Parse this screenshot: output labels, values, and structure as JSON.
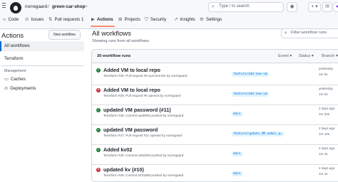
{
  "header": {
    "owner": "norregaard",
    "separator": "/",
    "repo": "green-car-shop",
    "lock_glyph": "⌂",
    "search_placeholder": "Type / to search",
    "plus_glyph": "+ ▾",
    "icon_glyphs": [
      "◉",
      "⇅",
      "✉",
      "●"
    ]
  },
  "tabs": [
    {
      "icon": "‹›",
      "label": "Code"
    },
    {
      "icon": "⊙",
      "label": "Issues"
    },
    {
      "icon": "⇅",
      "label": "Pull requests 1"
    },
    {
      "icon": "▶",
      "label": "Actions"
    },
    {
      "icon": "⊞",
      "label": "Projects"
    },
    {
      "icon": "⛉",
      "label": "Security"
    },
    {
      "icon": "↗",
      "label": "Insights"
    },
    {
      "icon": "⚙",
      "label": "Settings"
    }
  ],
  "sidebar": {
    "title": "Actions",
    "new_workflow": "New workflow",
    "all_workflows": "All workflows",
    "workflow_item": "Terraform",
    "management_heading": "Management",
    "caches_icon": "▭",
    "caches": "Caches",
    "deployments_icon": "⊙",
    "deployments": "Deployments"
  },
  "main": {
    "title": "All workflows",
    "subtitle": "Showing runs from all workflows",
    "filter_placeholder": "Filter workflow runs",
    "run_count": "30 workflow runs",
    "filters": [
      "Event ▾",
      "Status ▾",
      "Branch ▾"
    ]
  },
  "runs": [
    {
      "status": "success",
      "status_glyph": "✓",
      "title": "Added VM to local repo",
      "sub": "Terraform #30: Pull request #5 synchronize by norregaard",
      "branch": "feature/add-new-vm",
      "date": "yesterday",
      "duration": "1m 5s"
    },
    {
      "status": "failure",
      "status_glyph": "✕",
      "title": "Added VM to local repo",
      "sub": "Terraform #29: Pull request #5 opened by norregaard",
      "branch": "feature/add-new-vm",
      "date": "yesterday",
      "duration": "1m 0s"
    },
    {
      "status": "success",
      "status_glyph": "✓",
      "title": "updated VM password (#11)",
      "sub": "Terraform #28: Commit aa48094 pushed by norregaard",
      "branch": "main",
      "date": "2 days ago",
      "duration": "1m 20s"
    },
    {
      "status": "success",
      "status_glyph": "✓",
      "title": "updated VM password",
      "sub": "Terraform #27: Pull request #11 opened by norregaard",
      "branch": "feature/update_VM_admin_p…",
      "date": "2 days ago",
      "duration": "1m 10s"
    },
    {
      "status": "success",
      "status_glyph": "✓",
      "title": "Added kv02",
      "sub": "Terraform #26: Commit e2bd260 pushed by norregaard",
      "branch": "main",
      "date": "2 days ago",
      "duration": "1m 2s"
    },
    {
      "status": "failure",
      "status_glyph": "✕",
      "title": "updated kv (#10)",
      "sub": "Terraform #25: Commit 4231556 pushed by norregaard",
      "branch": "main",
      "date": "2 days ago",
      "duration": "1m 1s"
    }
  ]
}
